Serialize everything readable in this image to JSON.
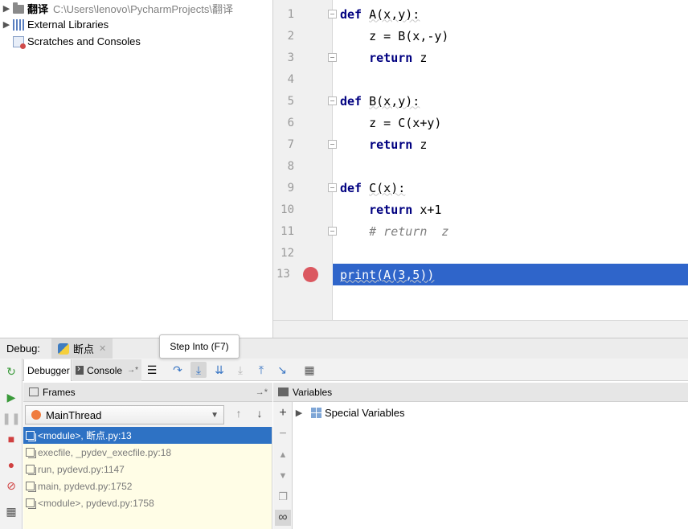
{
  "project_tree": {
    "items": [
      {
        "label": "翻译",
        "path": "C:\\Users\\lenovo\\PycharmProjects\\翻译",
        "icon": "folder-icon"
      },
      {
        "label": "External Libraries",
        "icon": "library-icon"
      },
      {
        "label": "Scratches and Consoles",
        "icon": "scratches-icon"
      }
    ]
  },
  "editor": {
    "lines": [
      {
        "n": "1",
        "code": "def A(x,y):"
      },
      {
        "n": "2",
        "code": "    z = B(x,-y)"
      },
      {
        "n": "3",
        "code": "    return z"
      },
      {
        "n": "4",
        "code": ""
      },
      {
        "n": "5",
        "code": "def B(x,y):"
      },
      {
        "n": "6",
        "code": "    z = C(x+y)"
      },
      {
        "n": "7",
        "code": "    return z"
      },
      {
        "n": "8",
        "code": ""
      },
      {
        "n": "9",
        "code": "def C(x):"
      },
      {
        "n": "10",
        "code": "    return x+1"
      },
      {
        "n": "11",
        "code": "    # return  z"
      },
      {
        "n": "12",
        "code": ""
      },
      {
        "n": "13",
        "code": "print(A(3,5))"
      }
    ],
    "breakpoint_line": "13",
    "accent_color": "#2f65ca",
    "breakpoint_color": "#db5860"
  },
  "debug": {
    "label": "Debug:",
    "session_tab": "断点",
    "tooltip": "Step Into (F7)",
    "tabs": {
      "debugger": "Debugger",
      "console": "Console"
    },
    "frames": {
      "title": "Frames",
      "thread": "MainThread",
      "items": [
        "<module>, 断点.py:13",
        "execfile, _pydev_execfile.py:18",
        "run, pydevd.py:1147",
        "main, pydevd.py:1752",
        "<module>, pydevd.py:1758"
      ]
    },
    "variables": {
      "title": "Variables",
      "items": [
        "Special Variables"
      ]
    }
  }
}
